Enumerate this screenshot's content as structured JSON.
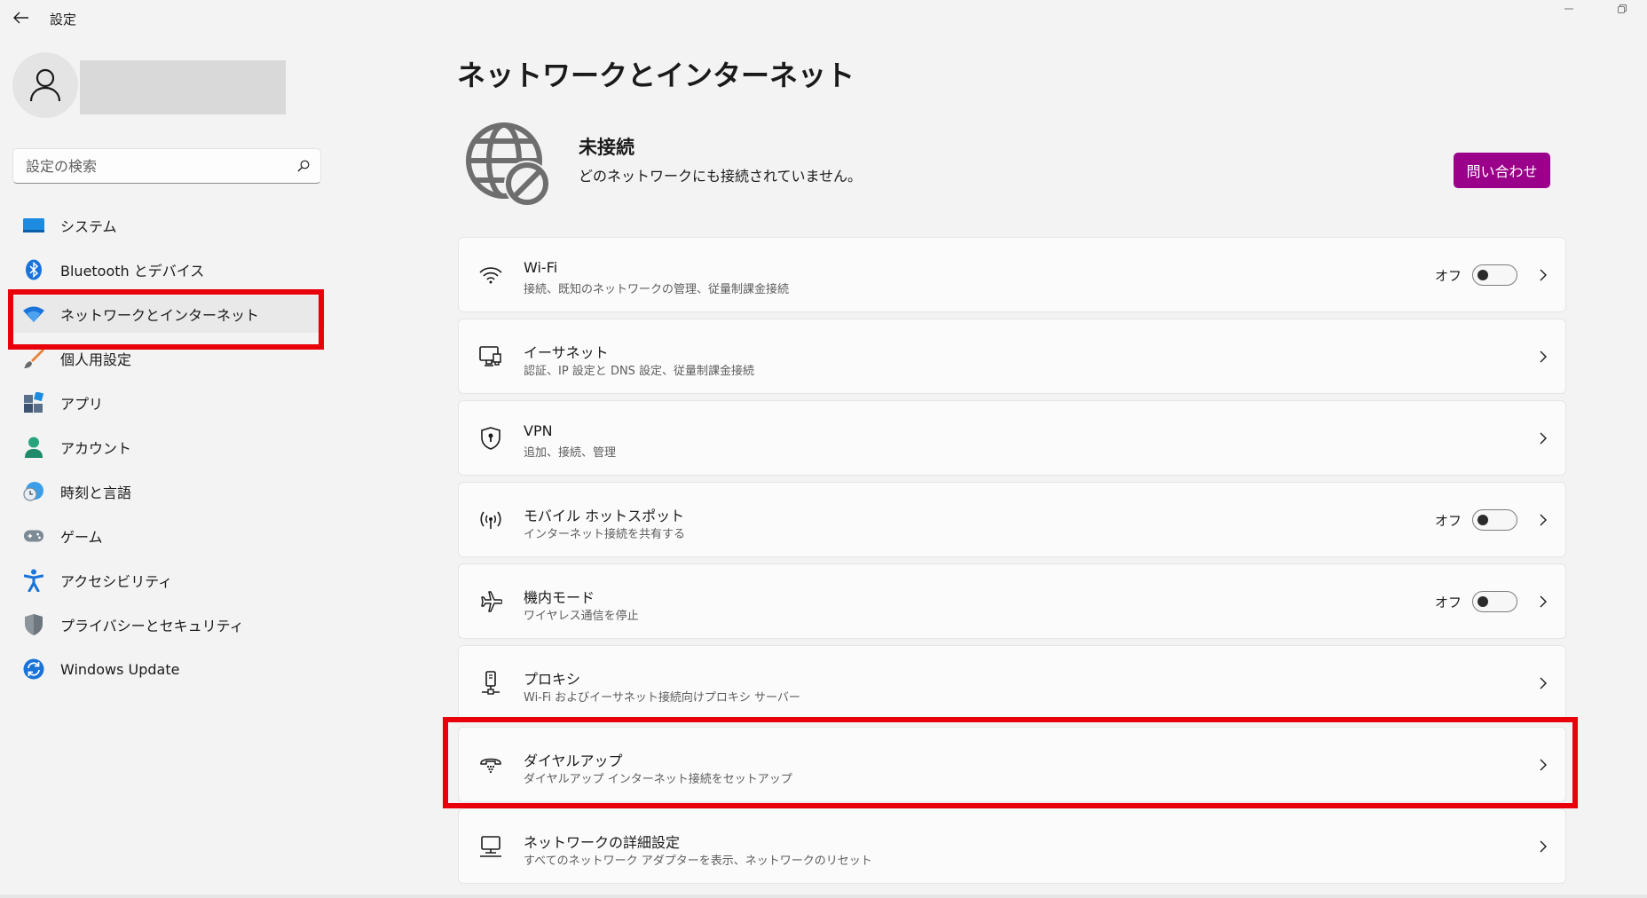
{
  "titlebar": {
    "app_title": "設定"
  },
  "sidebar": {
    "search_placeholder": "設定の検索",
    "items": [
      {
        "label": "システム",
        "icon": "system-icon",
        "active": false
      },
      {
        "label": "Bluetooth とデバイス",
        "icon": "bluetooth-icon",
        "active": false
      },
      {
        "label": "ネットワークとインターネット",
        "icon": "wifi-icon",
        "active": true
      },
      {
        "label": "個人用設定",
        "icon": "paintbrush-icon",
        "active": false
      },
      {
        "label": "アプリ",
        "icon": "apps-icon",
        "active": false
      },
      {
        "label": "アカウント",
        "icon": "account-icon",
        "active": false
      },
      {
        "label": "時刻と言語",
        "icon": "clock-globe-icon",
        "active": false
      },
      {
        "label": "ゲーム",
        "icon": "gamepad-icon",
        "active": false
      },
      {
        "label": "アクセシビリティ",
        "icon": "accessibility-icon",
        "active": false
      },
      {
        "label": "プライバシーとセキュリティ",
        "icon": "shield-icon",
        "active": false
      },
      {
        "label": "Windows Update",
        "icon": "update-icon",
        "active": false
      }
    ]
  },
  "main": {
    "page_title": "ネットワークとインターネット",
    "status": {
      "title": "未接続",
      "subtitle": "どのネットワークにも接続されていません。",
      "button_label": "問い合わせ"
    },
    "cards": [
      {
        "title": "Wi-Fi",
        "subtitle": "接続、既知のネットワークの管理、従量制課金接続",
        "state": "オフ",
        "icon": "wifi-icon"
      },
      {
        "title": "イーサネット",
        "subtitle": "認証、IP 設定と DNS 設定、従量制課金接続",
        "icon": "ethernet-icon"
      },
      {
        "title": "VPN",
        "subtitle": "追加、接続、管理",
        "icon": "vpn-shield-icon"
      },
      {
        "title": "モバイル ホットスポット",
        "subtitle": "インターネット接続を共有する",
        "state": "オフ",
        "icon": "hotspot-icon"
      },
      {
        "title": "機内モード",
        "subtitle": "ワイヤレス通信を停止",
        "state": "オフ",
        "icon": "airplane-icon"
      },
      {
        "title": "プロキシ",
        "subtitle": "Wi-Fi およびイーサネット接続向けプロキシ サーバー",
        "icon": "proxy-icon"
      },
      {
        "title": "ダイヤルアップ",
        "subtitle": "ダイヤルアップ インターネット接続をセットアップ",
        "icon": "dialup-icon"
      },
      {
        "title": "ネットワークの詳細設定",
        "subtitle": "すべてのネットワーク アダプターを表示、ネットワークのリセット",
        "icon": "network-pc-icon"
      }
    ]
  },
  "colors": {
    "accent": "#0067c0",
    "contact_button": "#9a0089",
    "highlight": "#e8000b"
  }
}
